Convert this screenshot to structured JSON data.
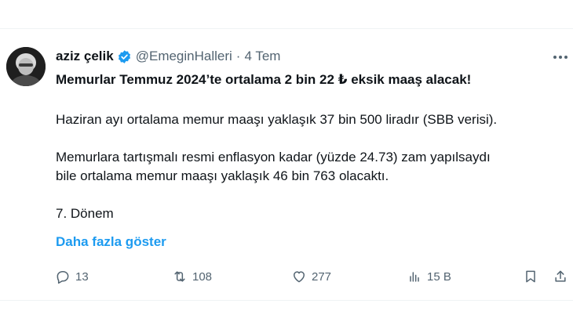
{
  "tweet": {
    "author_name": "aziz çelik",
    "handle": "@EmeginHalleri",
    "separator": "·",
    "date": "4 Tem",
    "headline": "Memurlar Temmuz 2024’te ortalama 2 bin 22 ₺ eksik maaş alacak!",
    "paragraph_1": "Haziran ayı ortalama memur maaşı yaklaşık 37 bin 500 liradır (SBB verisi).",
    "paragraph_2_line_1": "Memurlara tartışmalı resmi enflasyon kadar (yüzde 24.73) zam yapılsaydı",
    "paragraph_2_line_2": "bile ortalama memur maaşı yaklaşık 46 bin 763 olacaktı.",
    "paragraph_3": "7. Dönem",
    "show_more": "Daha fazla göster"
  },
  "actions": {
    "replies": "13",
    "retweets": "108",
    "likes": "277",
    "views": "15 B"
  },
  "colors": {
    "accent": "#1d9bf0",
    "text": "#0f1419",
    "secondary": "#536471",
    "divider": "#eff3f4"
  },
  "icons": [
    "verified-badge-icon",
    "more-icon",
    "reply-icon",
    "retweet-icon",
    "like-icon",
    "views-icon",
    "bookmark-icon",
    "share-icon"
  ]
}
